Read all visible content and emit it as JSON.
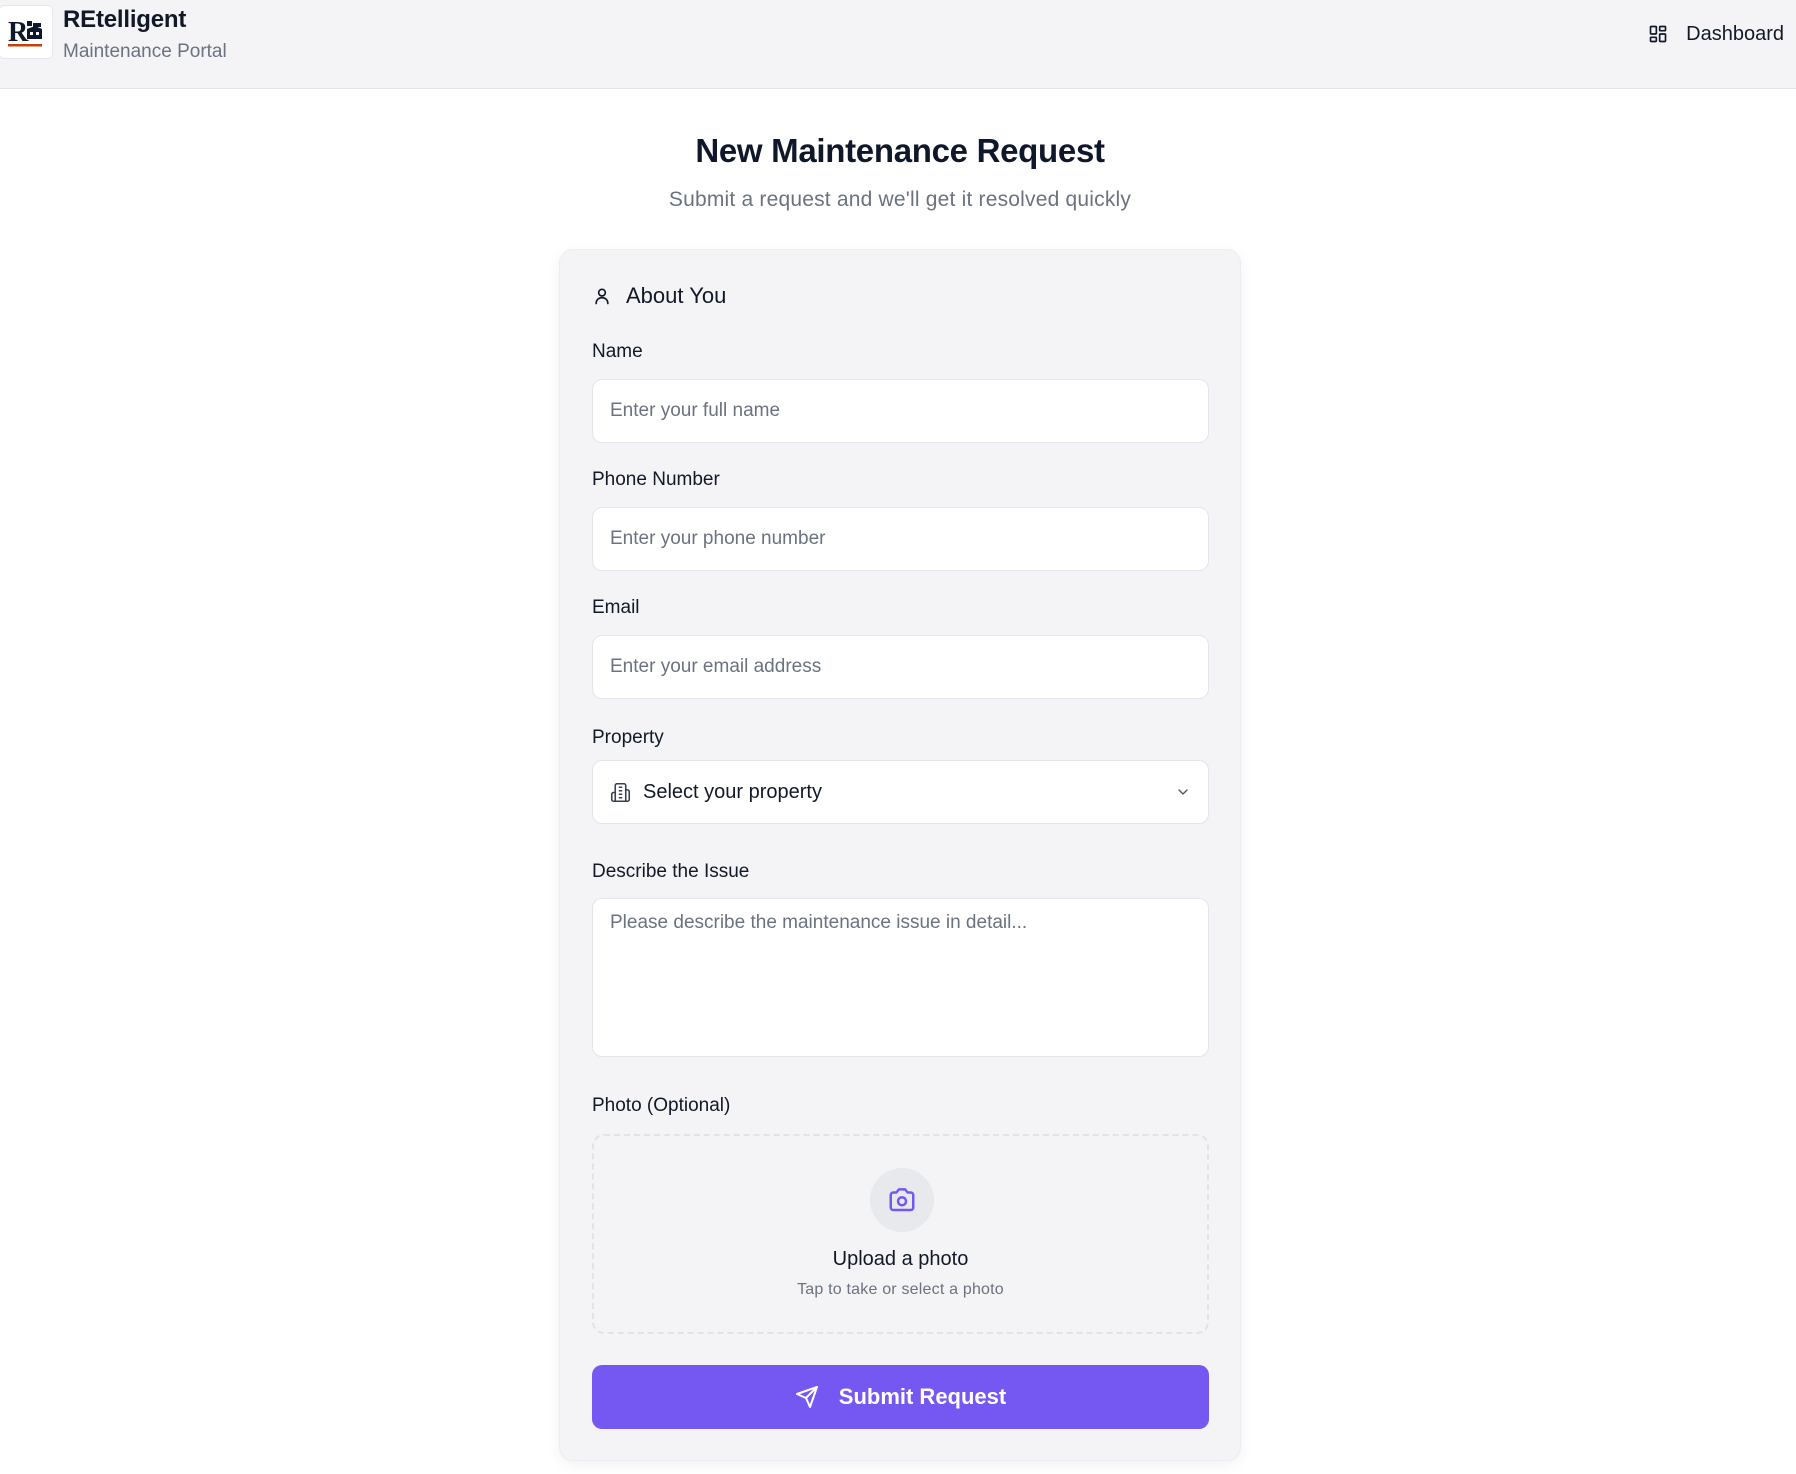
{
  "header": {
    "logo_text": "R",
    "app_title": "REtelligent",
    "app_subtitle": "Maintenance Portal",
    "nav_dashboard_label": "Dashboard",
    "nav_dashboard_icon": "layout-dashboard-icon"
  },
  "page": {
    "title": "New Maintenance Request",
    "subtitle": "Submit a request and we'll get it resolved quickly"
  },
  "form": {
    "section_title": "About You",
    "section_icon": "user-icon",
    "name": {
      "label": "Name",
      "value": "",
      "placeholder": "Enter your full name"
    },
    "phone": {
      "label": "Phone Number",
      "value": "",
      "placeholder": "Enter your phone number"
    },
    "email": {
      "label": "Email",
      "value": "",
      "placeholder": "Enter your email address"
    },
    "property": {
      "label": "Property",
      "selected": "Select your property",
      "icon": "building-icon"
    },
    "issue": {
      "label": "Describe the Issue",
      "value": "",
      "placeholder": "Please describe the maintenance issue in detail..."
    },
    "photo": {
      "label": "Photo (Optional)",
      "upload_title": "Upload a photo",
      "upload_hint": "Tap to take or select a photo",
      "icon": "camera-icon"
    },
    "submit_label": "Submit Request",
    "submit_icon": "send-icon"
  },
  "colors": {
    "accent": "#7558f2",
    "header_bg": "#f4f4f6",
    "card_bg": "#f4f4f6",
    "muted_text": "#6b7280"
  }
}
